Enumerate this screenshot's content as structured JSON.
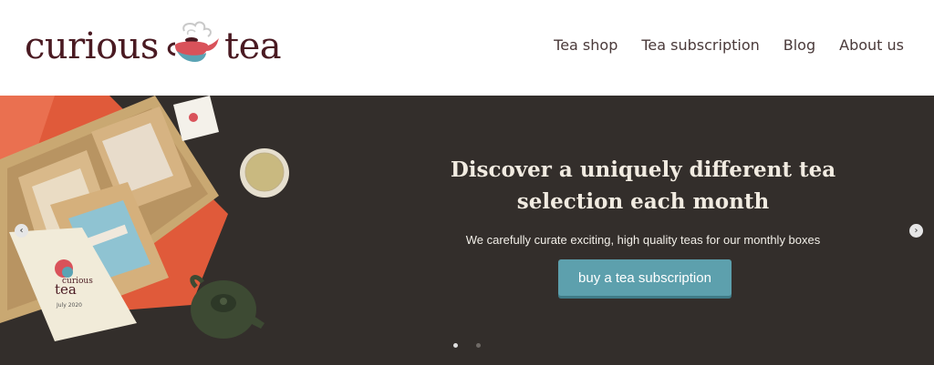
{
  "logo": {
    "word1": "curious",
    "word2": "tea"
  },
  "nav": {
    "items": [
      {
        "label": "Tea shop"
      },
      {
        "label": "Tea subscription"
      },
      {
        "label": "Blog"
      },
      {
        "label": "About us"
      }
    ]
  },
  "hero": {
    "title_line1": "Discover a uniquely different tea",
    "title_line2": "selection each month",
    "subtitle": "We carefully curate exciting, high quality teas for our monthly boxes",
    "cta_label": "buy a tea subscription",
    "carousel": {
      "slides": 2,
      "active_slide": 1
    },
    "packet_brand": "curious",
    "packet_name": "tea",
    "packet_date": "July 2020"
  },
  "colors": {
    "brand_dark": "#4a1a22",
    "teapot_red": "#d9525a",
    "teapot_blue": "#5aa3b4",
    "hero_bg": "#332e2b",
    "cta": "#5da0ad",
    "heading": "#f1ebe1"
  },
  "icons": {
    "prev": "chevron-left-icon",
    "next": "chevron-right-icon",
    "logo_mark": "teapot-icon"
  }
}
